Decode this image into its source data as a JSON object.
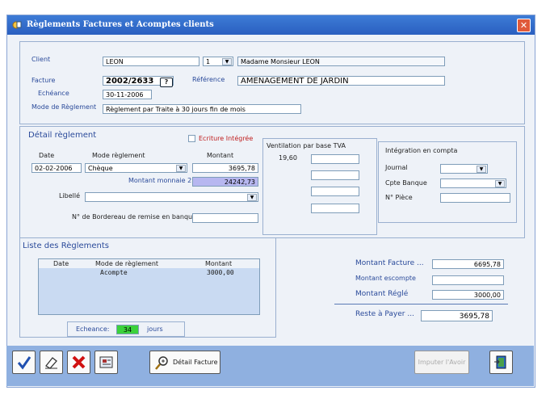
{
  "window": {
    "title": "Règlements Factures et Acomptes clients",
    "close_glyph": "✕"
  },
  "client": {
    "client_label": "Client",
    "client_value": "LEON",
    "num_value": "1",
    "name_value": "Madame Monsieur LEON",
    "facture_label": "Facture",
    "facture_value": "2002/2633",
    "help_glyph": "?",
    "reference_label": "Référence",
    "reference_value": "AMENAGEMENT DE JARDIN",
    "echeance_label": "Echéance",
    "echeance_value": "30-11-2006",
    "mode_label": "Mode de Règlement",
    "mode_value": "Règlement par Traite à 30 jours fin de mois"
  },
  "detail": {
    "title": "Détail règlement",
    "ecriture_label": "Ecriture Intégrée",
    "date_label": "Date",
    "date_value": "02-02-2006",
    "mode_label": "Mode règlement",
    "mode_value": "Chèque",
    "montant_label": "Montant",
    "montant_value": "3695,78",
    "montant_monnaie_label": "Montant  monnaie 2",
    "montant_monnaie_value": "24242,73",
    "libelle_label": "Libellé",
    "bordereau_label": "N° de Bordereau de remise en banque"
  },
  "tva": {
    "title": "Ventilation par base TVA",
    "rate": "19,60"
  },
  "compta": {
    "title": "Intégration en compta",
    "journal_label": "Journal",
    "banque_label": "Cpte Banque",
    "piece_label": "N° Pièce"
  },
  "liste": {
    "title": "Liste des Règlements",
    "columns": [
      "Date",
      "Mode de règlement",
      "Montant"
    ],
    "rows": [
      {
        "date": "",
        "mode": "Acompte",
        "montant": "3000,00"
      }
    ],
    "echeance_label": "Echeance:",
    "echeance_value": "34",
    "jours_label": "jours"
  },
  "totals": {
    "facture_label": "Montant Facture ...",
    "facture_value": "6695,78",
    "escompte_label": "Montant escompte",
    "escompte_value": "",
    "regle_label": "Montant Réglé",
    "regle_value": "3000,00",
    "reste_label": "Reste à Payer ...",
    "reste_value": "3695,78"
  },
  "toolbar": {
    "detail_facture_label": "Détail Facture",
    "imputer_label": "Imputer l'Avoir"
  },
  "colors": {
    "title_bar": "#2a5fc0",
    "window_bg": "#eef2f8",
    "highlight_field": "#b7b7f0",
    "echeance_green": "#3cd23c",
    "bottom_bar": "#8fb0e0"
  }
}
